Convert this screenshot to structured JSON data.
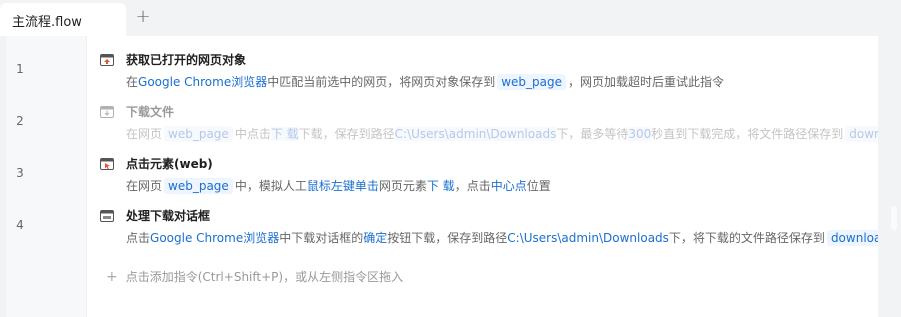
{
  "tabs": [
    {
      "label": "主流程.flow",
      "active": true
    }
  ],
  "new_tab_symbol": "+",
  "lines": [
    "1",
    "2",
    "3",
    "4"
  ],
  "rows": [
    {
      "icon": "browser-open-icon",
      "title": "获取已打开的网页对象",
      "disabled": false,
      "desc": [
        {
          "t": "在"
        },
        {
          "t": "Google Chrome浏览器",
          "k": "hl"
        },
        {
          "t": "中匹配当前选中的网页，将网页对象保存到"
        },
        {
          "t": "web_page",
          "k": "chip"
        },
        {
          "t": "，网页加载超时后重试此指令"
        }
      ]
    },
    {
      "icon": "download-file-icon",
      "title": "下载文件",
      "disabled": true,
      "desc": [
        {
          "t": "在网页"
        },
        {
          "t": "web_page",
          "k": "chip"
        },
        {
          "t": "中点击"
        },
        {
          "t": "下 载",
          "k": "hl"
        },
        {
          "t": "下载，保存到路径"
        },
        {
          "t": "C:\\Users\\admin\\Downloads",
          "k": "hl"
        },
        {
          "t": "下，最多等待"
        },
        {
          "t": "300",
          "k": "hl"
        },
        {
          "t": "秒直到下载完成，将文件路径保存到"
        },
        {
          "t": "downlo",
          "k": "chip"
        }
      ]
    },
    {
      "icon": "click-element-icon",
      "title": "点击元素(web)",
      "disabled": false,
      "desc": [
        {
          "t": "在网页"
        },
        {
          "t": "web_page",
          "k": "chip"
        },
        {
          "t": "中，模拟人工"
        },
        {
          "t": "鼠标左键单击",
          "k": "hl"
        },
        {
          "t": "网页元素"
        },
        {
          "t": "下 载",
          "k": "hl"
        },
        {
          "t": "，点击"
        },
        {
          "t": "中心点",
          "k": "hl"
        },
        {
          "t": "位置"
        }
      ]
    },
    {
      "icon": "download-dialog-icon",
      "title": "处理下载对话框",
      "disabled": false,
      "desc": [
        {
          "t": "点击"
        },
        {
          "t": "Google Chrome浏览器",
          "k": "hl"
        },
        {
          "t": "中下载对话框的"
        },
        {
          "t": "确定",
          "k": "hl"
        },
        {
          "t": "按钮下载，保存到路径"
        },
        {
          "t": "C:\\Users\\admin\\Downloads",
          "k": "hl"
        },
        {
          "t": "下，将下载的文件路径保存到"
        },
        {
          "t": "downloa",
          "k": "chip"
        }
      ]
    }
  ],
  "add_hint": {
    "symbol": "+",
    "text": "点击添加指令(Ctrl+Shift+P)，或从左侧指令区拖入"
  },
  "colors": {
    "accent": "#1a6fd1",
    "chip_bg": "#eef5ff",
    "disabled_text": "#c4c4c4"
  }
}
